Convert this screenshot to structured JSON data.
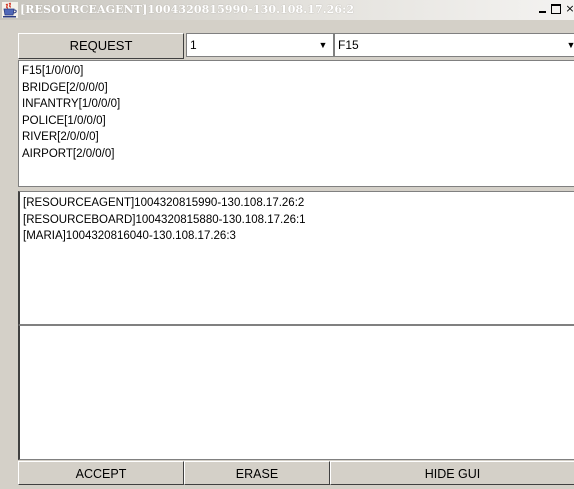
{
  "window": {
    "title": "[RESOURCEAGENT]1004320815990-130.108.17.26:2",
    "icon": "java-cup-icon",
    "controls": {
      "minimize": "minimize-icon",
      "maximize": "maximize-icon",
      "close_label": "×"
    }
  },
  "request_row": {
    "request_label": "REQUEST",
    "quantity_value": "1",
    "resource_value": "F15",
    "dropdown_arrow": "▼"
  },
  "resources_list": [
    "F15[1/0/0/0]",
    "BRIDGE[2/0/0/0]",
    "INFANTRY[1/0/0/0]",
    "POLICE[1/0/0/0]",
    "RIVER[2/0/0/0]",
    "AIRPORT[2/0/0/0]"
  ],
  "agents_list": [
    "[RESOURCEAGENT]1004320815990-130.108.17.26:2",
    "[RESOURCEBOARD]1004320815880-130.108.17.26:1",
    "[MARIA]1004320816040-130.108.17.26:3"
  ],
  "log_text": "",
  "buttons": {
    "accept": "ACCEPT",
    "erase": "ERASE",
    "hide_gui": "HIDE GUI"
  },
  "colors": {
    "window_bg": "#d4d0c8",
    "panel_bg": "#ffffff",
    "title_text": "#ffffff"
  }
}
